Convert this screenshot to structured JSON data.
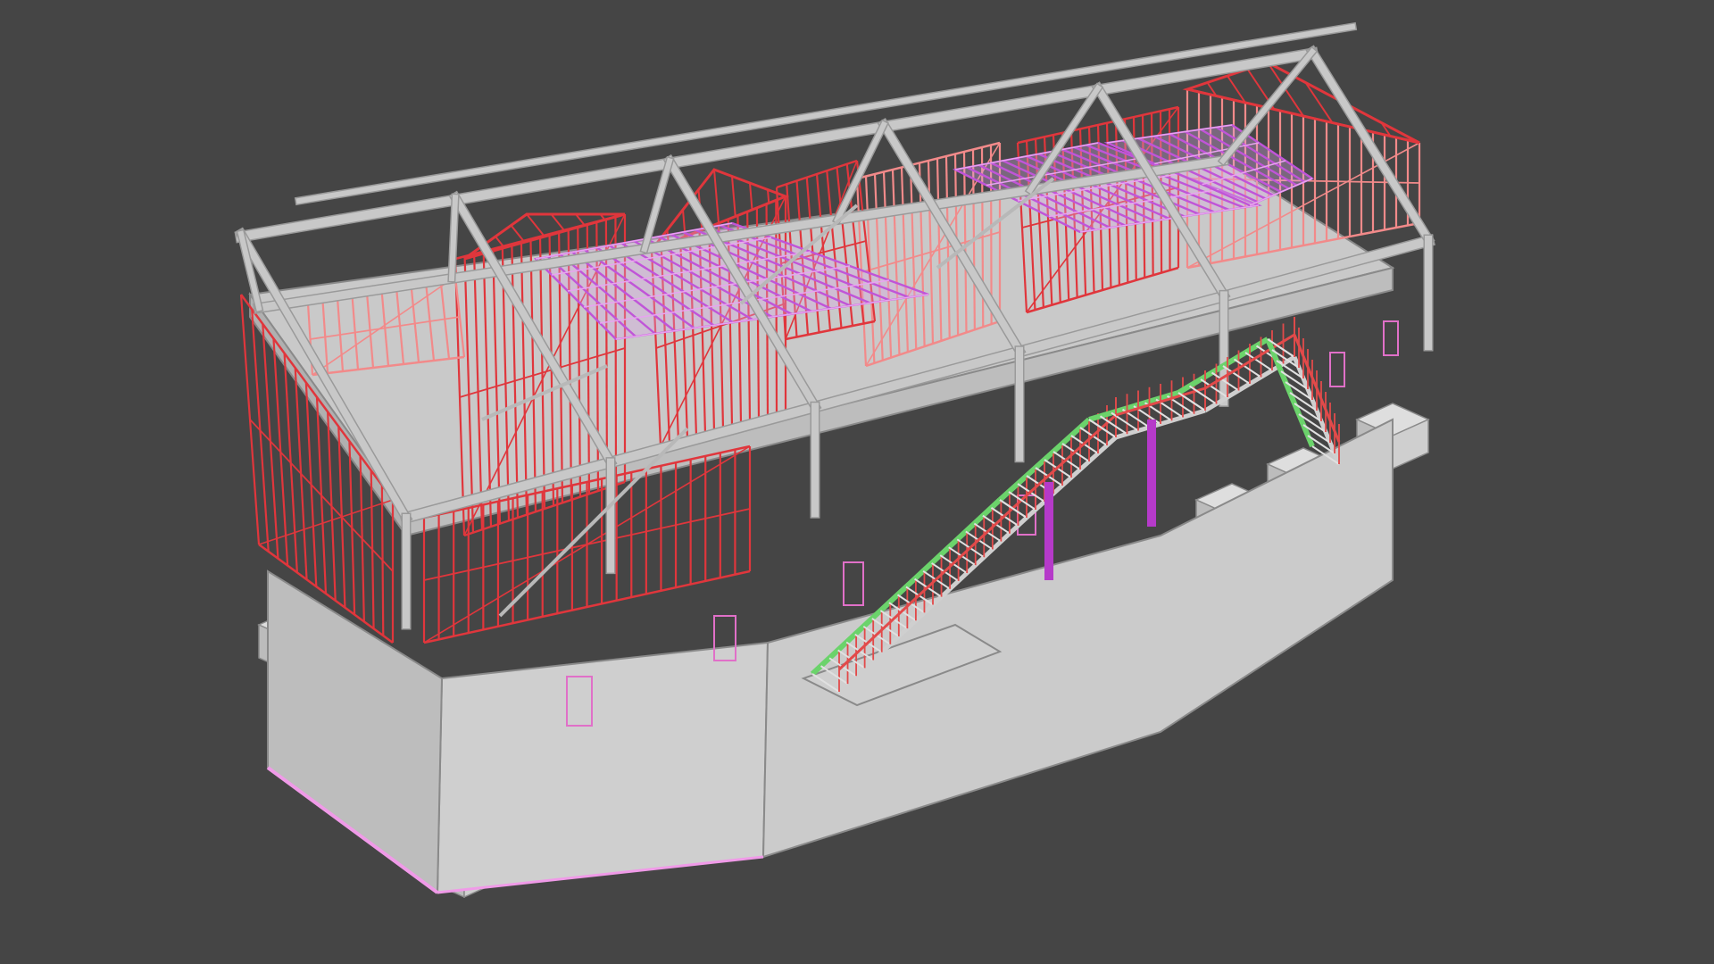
{
  "scene": {
    "subject": "isometric-structural-building-model",
    "background_color": "#454545",
    "colors": {
      "concrete": "#d0d0d0",
      "concrete_shadow": "#b5b5b5",
      "concrete_edge": "#8a8a8a",
      "steel_frame": "#c8c8c8",
      "wall_studs": "#e0363c",
      "wall_studs_light": "#f28a8a",
      "floor_joists": "#c055d8",
      "floor_joists_light": "#e8a3f0",
      "stair_stringer": "#6bd36b",
      "stair_rail": "#e24a4a",
      "columns_accent": "#b53ac9"
    }
  }
}
